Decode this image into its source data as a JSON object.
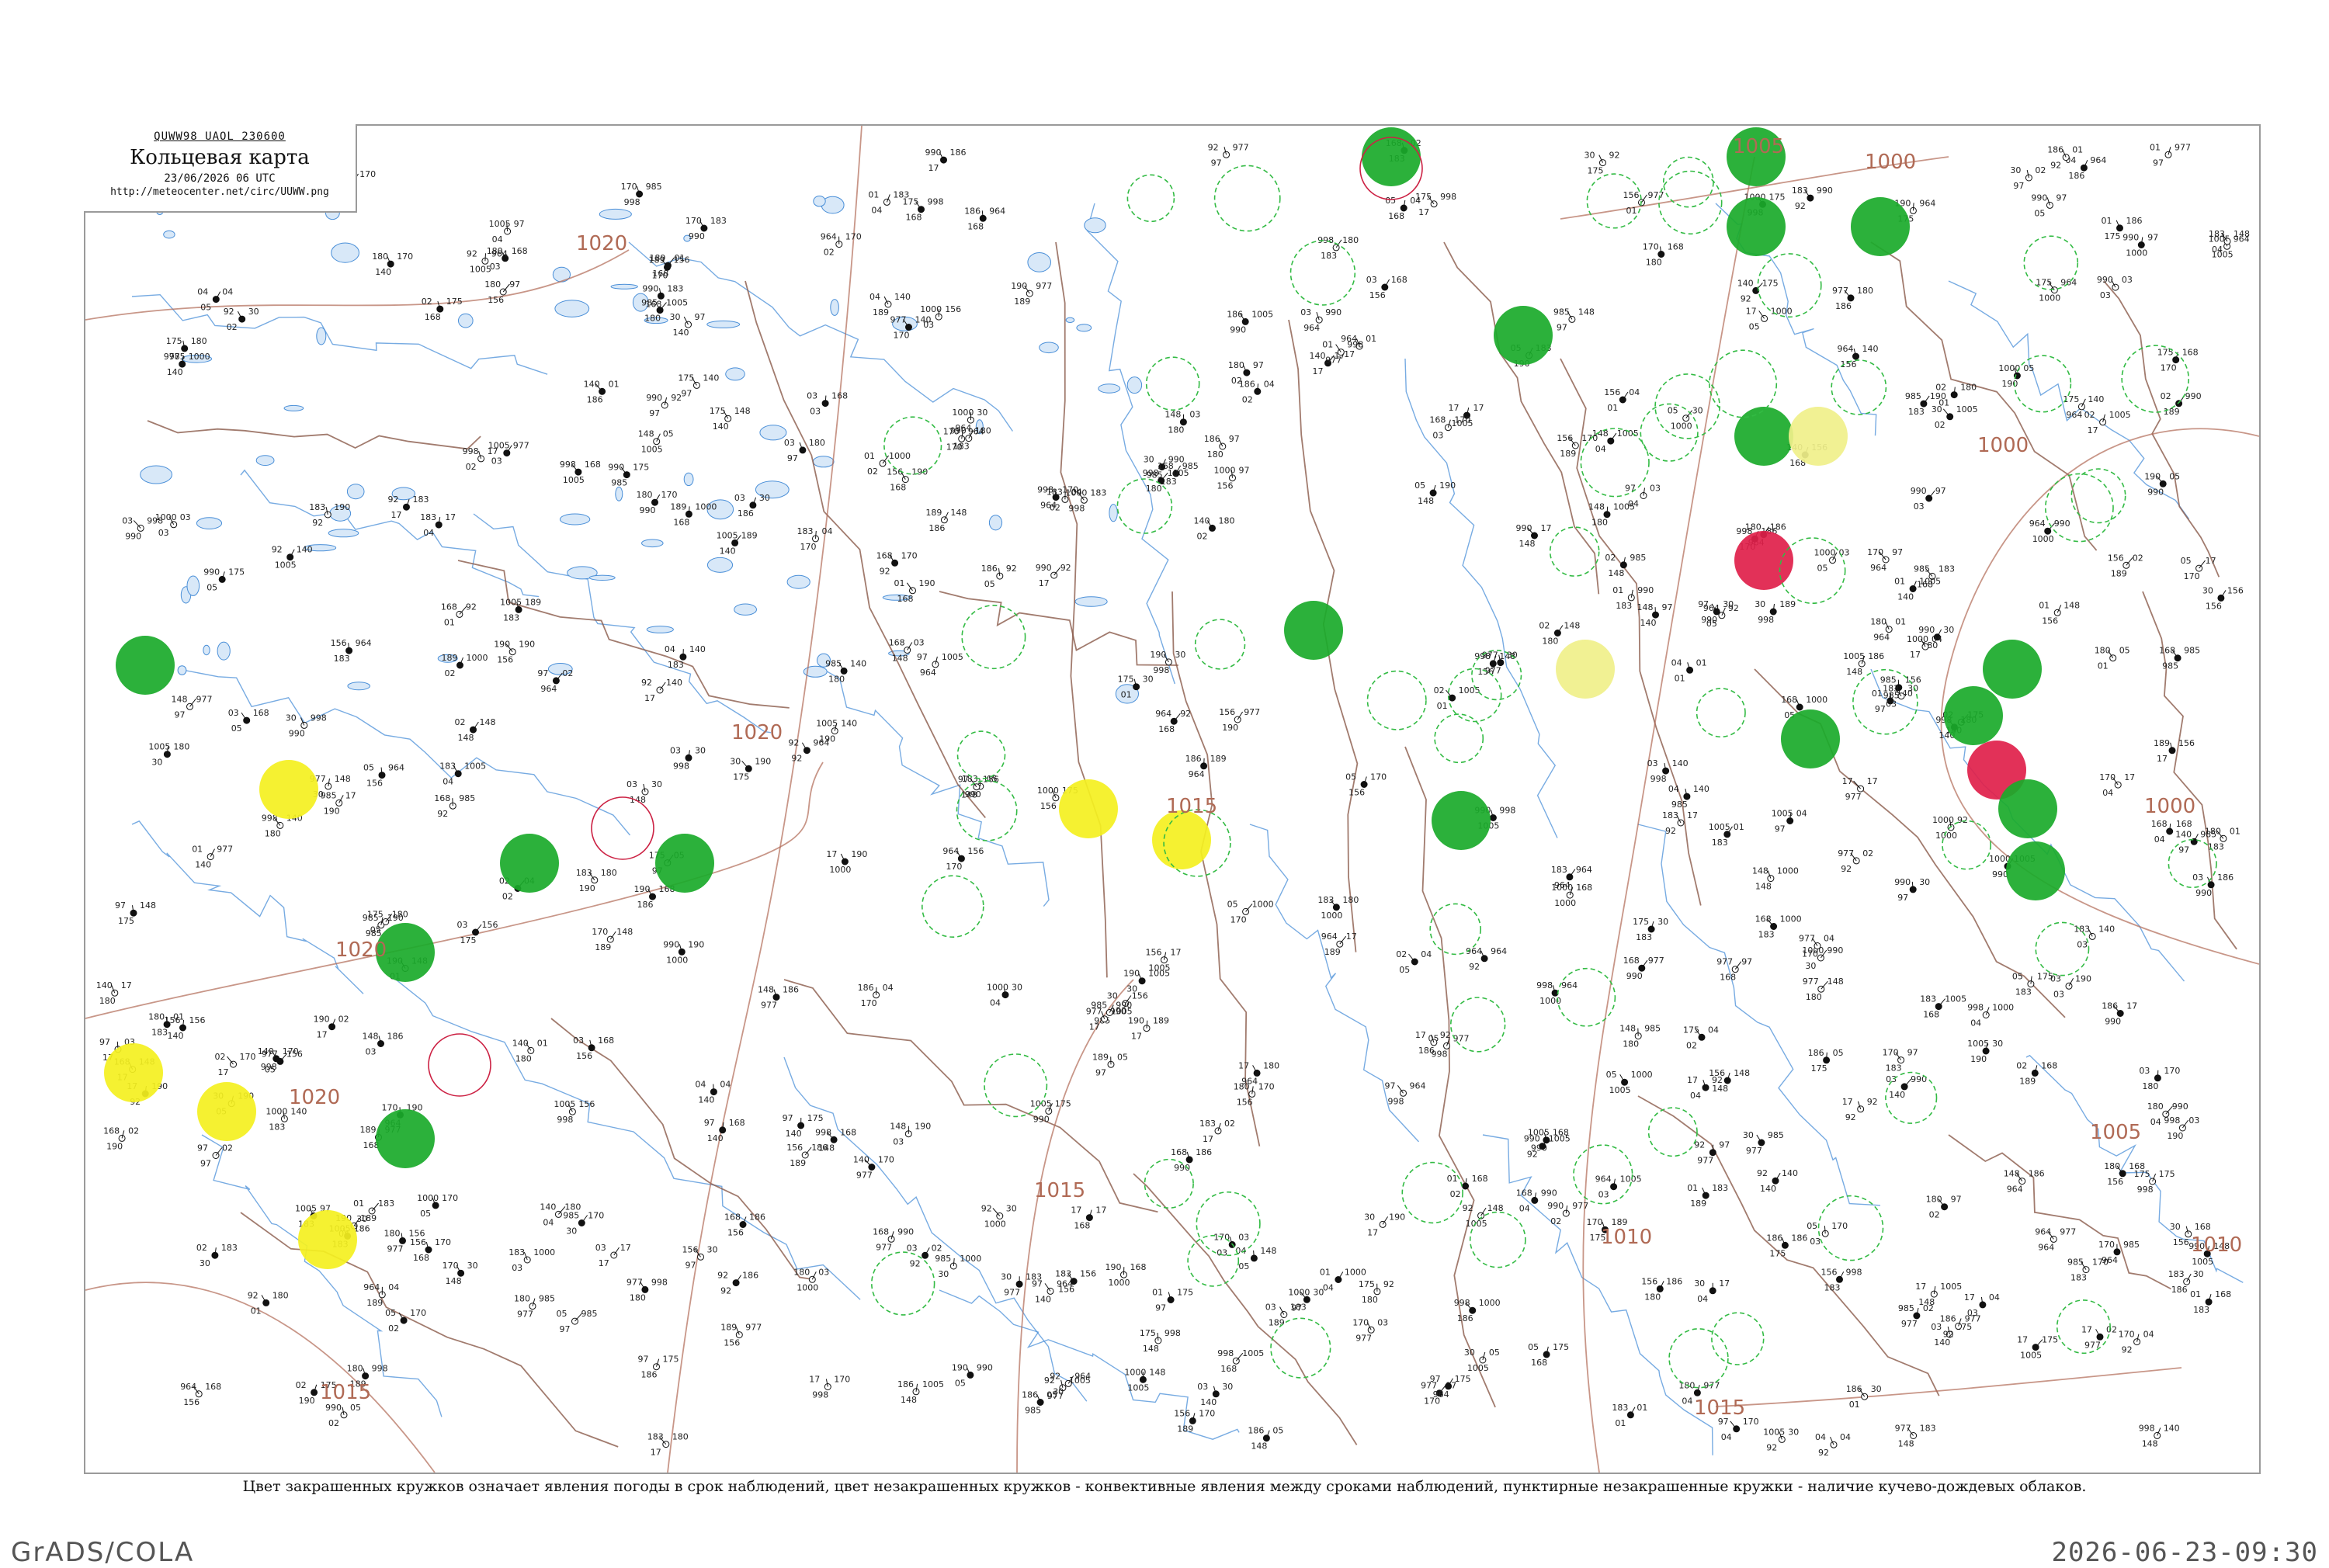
{
  "header": {
    "code": "QUWW98 UAOL 230600",
    "title": "Кольцевая карта",
    "date": "23/06/2026 06 UTC",
    "url": "http://meteocenter.net/circ/UUWW.png"
  },
  "legend": "Цвет закрашенных кружков означает явления погоды в срок наблюдений, цвет незакрашенных кружков - конвективные явления между сроками наблюдений, пунктирные незакрашенные кружки - наличие кучево-дождевых облаков.",
  "footer": {
    "left": "GrADS/COLA",
    "right": "2026-06-23-09:30"
  },
  "colors": {
    "isobar": "#b06a55",
    "water": "#4a8fd8",
    "road": "#8a5a4a",
    "circle_green": "#1aaa2a",
    "circle_yellow": "#f4f020",
    "circle_red": "#e0204a",
    "circle_lightgreen": "#66dd88",
    "circle_paleyellow": "#f0f08a",
    "dashed_green": "#33bb44",
    "ring_red": "#cc2244"
  },
  "isobar_labels": [
    {
      "text": "1020",
      "place": "northwest"
    },
    {
      "text": "1020",
      "place": "west-center"
    },
    {
      "text": "1020",
      "place": "southwest"
    },
    {
      "text": "1020",
      "place": "center-west"
    },
    {
      "text": "1015",
      "place": "center"
    },
    {
      "text": "1015",
      "place": "south-center"
    },
    {
      "text": "1015",
      "place": "southwest-bottom"
    },
    {
      "text": "1015",
      "place": "south-east"
    },
    {
      "text": "1010",
      "place": "southeast"
    },
    {
      "text": "1010",
      "place": "south-center-east"
    },
    {
      "text": "1005",
      "place": "north"
    },
    {
      "text": "1005",
      "place": "east"
    },
    {
      "text": "1000",
      "place": "north-east"
    },
    {
      "text": "1000",
      "place": "east-center"
    },
    {
      "text": "1000",
      "place": "far-east"
    }
  ],
  "highlighted_stations": {
    "filled_green": 22,
    "filled_yellow": 6,
    "filled_red": 2,
    "filled_lightgreen": 1,
    "red_rings": 4
  },
  "sample_station_values": [
    "97",
    "92",
    "168",
    "156",
    "183",
    "189",
    "170",
    "148",
    "140",
    "180",
    "190",
    "186",
    "175",
    "03",
    "04",
    "05",
    "01",
    "02",
    "17",
    "30",
    "985",
    "990",
    "998",
    "977",
    "964",
    "1005",
    "1000"
  ]
}
